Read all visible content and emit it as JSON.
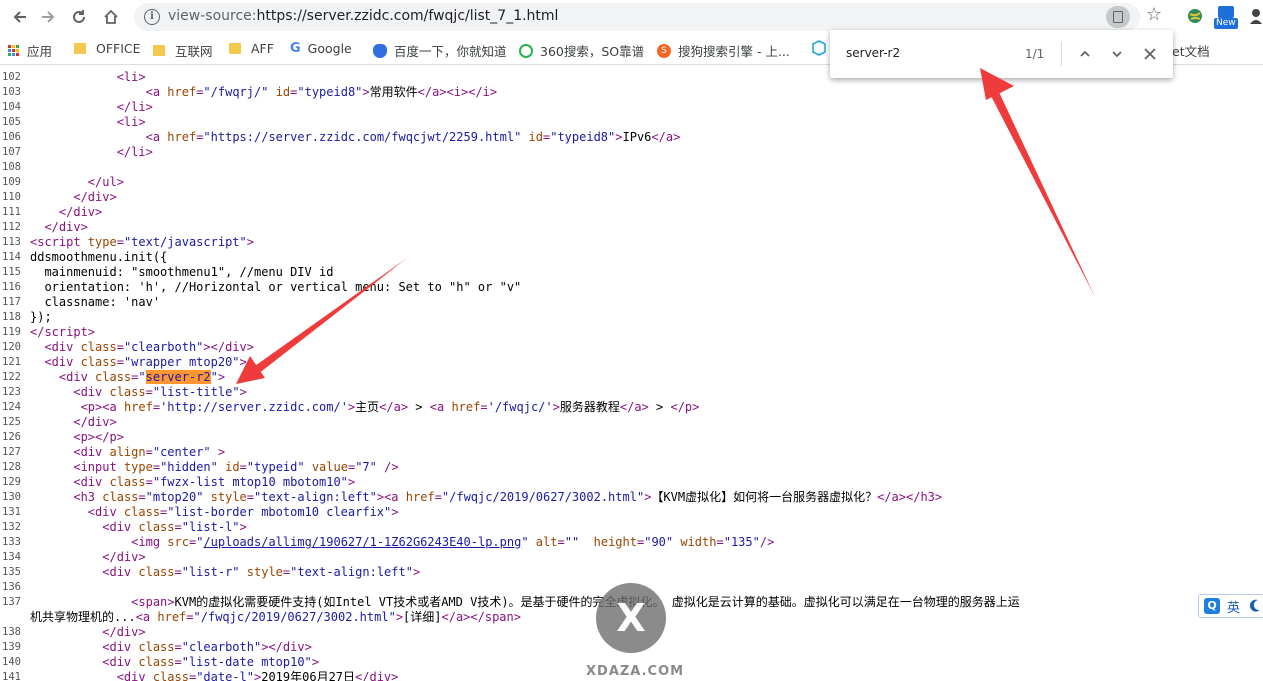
{
  "browser": {
    "url_prefix": "view-source:",
    "url_main": "https://server.zzidc.com/fwqjc/list_7_1.html",
    "new_badge": "New"
  },
  "bookmarks": [
    {
      "label": "应用",
      "icon": "apps-grid-icon"
    },
    {
      "label": "OFFICE",
      "icon": "folder-icon"
    },
    {
      "label": "互联网",
      "icon": "folder-icon"
    },
    {
      "label": "AFF",
      "icon": "folder-icon"
    },
    {
      "label": "Google",
      "icon": "google-icon"
    },
    {
      "label": "百度一下，你就知道",
      "icon": "baidu-icon"
    },
    {
      "label": "360搜索，SO靠谱",
      "icon": "so360-icon"
    },
    {
      "label": "搜狗搜索引擎 - 上...",
      "icon": "sogou-icon"
    },
    {
      "label": "et文档",
      "icon": "doc-icon"
    }
  ],
  "find_bar": {
    "query": "server-r2",
    "count": "1/1"
  },
  "code_lines": [
    {
      "n": "102",
      "html": "            <span class=\"t\">&lt;li&gt;</span>"
    },
    {
      "n": "103",
      "html": "                <span class=\"t\">&lt;a </span><span class=\"a\">href</span><span class=\"t\">=</span><span class=\"v\">\"/fwqrj/\"</span> <span class=\"a\">id</span><span class=\"t\">=</span><span class=\"v\">\"typeid8\"</span><span class=\"t\">&gt;</span>常用软件<span class=\"t\">&lt;/a&gt;&lt;i&gt;&lt;/i&gt;</span>"
    },
    {
      "n": "104",
      "html": "            <span class=\"t\">&lt;/li&gt;</span>"
    },
    {
      "n": "105",
      "html": "            <span class=\"t\">&lt;li&gt;</span>"
    },
    {
      "n": "106",
      "html": "                <span class=\"t\">&lt;a </span><span class=\"a\">href</span><span class=\"t\">=</span><span class=\"v\">\"https://server.zzidc.com/fwqcjwt/2259.html\"</span> <span class=\"a\">id</span><span class=\"t\">=</span><span class=\"v\">\"typeid8\"</span><span class=\"t\">&gt;</span>IPv6<span class=\"t\">&lt;/a&gt;</span>"
    },
    {
      "n": "107",
      "html": "            <span class=\"t\">&lt;/li&gt;</span>"
    },
    {
      "n": "108",
      "html": ""
    },
    {
      "n": "109",
      "html": "        <span class=\"t\">&lt;/ul&gt;</span>"
    },
    {
      "n": "110",
      "html": "      <span class=\"t\">&lt;/div&gt;</span>"
    },
    {
      "n": "111",
      "html": "    <span class=\"t\">&lt;/div&gt;</span>"
    },
    {
      "n": "112",
      "html": "  <span class=\"t\">&lt;/div&gt;</span>"
    },
    {
      "n": "113",
      "html": "<span class=\"t\">&lt;script </span><span class=\"a\">type</span><span class=\"t\">=</span><span class=\"v\">\"text/javascript\"</span><span class=\"t\">&gt;</span>"
    },
    {
      "n": "114",
      "html": "ddsmoothmenu.init({"
    },
    {
      "n": "115",
      "html": "  mainmenuid: \"smoothmenu1\", //menu DIV id"
    },
    {
      "n": "116",
      "html": "  orientation: 'h', //Horizontal or vertical menu: Set to \"h\" or \"v\""
    },
    {
      "n": "117",
      "html": "  classname: 'nav'"
    },
    {
      "n": "118",
      "html": "});"
    },
    {
      "n": "119",
      "html": "<span class=\"t\">&lt;/script&gt;</span>"
    },
    {
      "n": "120",
      "html": "  <span class=\"t\">&lt;div </span><span class=\"a\">class</span><span class=\"t\">=</span><span class=\"v\">\"clearboth\"</span><span class=\"t\">&gt;&lt;/div&gt;</span>"
    },
    {
      "n": "121",
      "html": "  <span class=\"t\">&lt;div </span><span class=\"a\">class</span><span class=\"t\">=</span><span class=\"v\">\"wrapper mtop20\"</span><span class=\"t\">&gt;</span>"
    },
    {
      "n": "122",
      "html": "    <span class=\"t\">&lt;div </span><span class=\"a\">class</span><span class=\"t\">=</span><span class=\"v\">\"<span class=\"hl\">server-r2</span>\"</span><span class=\"t\">&gt;</span>"
    },
    {
      "n": "123",
      "html": "      <span class=\"t\">&lt;div </span><span class=\"a\">class</span><span class=\"t\">=</span><span class=\"v\">\"list-title\"</span><span class=\"t\">&gt;</span>"
    },
    {
      "n": "124",
      "html": "       <span class=\"t\">&lt;p&gt;&lt;a </span><span class=\"a\">href</span><span class=\"t\">=</span><span class=\"v\">'http://server.zzidc.com/'</span><span class=\"t\">&gt;</span>主页<span class=\"t\">&lt;/a&gt;</span> &gt; <span class=\"t\">&lt;a </span><span class=\"a\">href</span><span class=\"t\">=</span><span class=\"v\">'/fwqjc/'</span><span class=\"t\">&gt;</span>服务器教程<span class=\"t\">&lt;/a&gt;</span> &gt; <span class=\"t\">&lt;/p&gt;</span>"
    },
    {
      "n": "125",
      "html": "      <span class=\"t\">&lt;/div&gt;</span>"
    },
    {
      "n": "126",
      "html": "      <span class=\"t\">&lt;p&gt;&lt;/p&gt;</span>"
    },
    {
      "n": "127",
      "html": "      <span class=\"t\">&lt;div </span><span class=\"a\">align</span><span class=\"t\">=</span><span class=\"v\">\"center\"</span> <span class=\"t\">&gt;</span>"
    },
    {
      "n": "128",
      "html": "      <span class=\"t\">&lt;input </span><span class=\"a\">type</span><span class=\"t\">=</span><span class=\"v\">\"hidden\"</span> <span class=\"a\">id</span><span class=\"t\">=</span><span class=\"v\">\"typeid\"</span> <span class=\"a\">value</span><span class=\"t\">=</span><span class=\"v\">\"7\"</span> <span class=\"t\">/&gt;</span>"
    },
    {
      "n": "129",
      "html": "      <span class=\"t\">&lt;div </span><span class=\"a\">class</span><span class=\"t\">=</span><span class=\"v\">\"fwzx-list mtop10 mbotom10\"</span><span class=\"t\">&gt;</span>"
    },
    {
      "n": "130",
      "html": "      <span class=\"t\">&lt;h3 </span><span class=\"a\">class</span><span class=\"t\">=</span><span class=\"v\">\"mtop20\"</span> <span class=\"a\">style</span><span class=\"t\">=</span><span class=\"v\">\"text-align:left\"</span><span class=\"t\">&gt;&lt;a </span><span class=\"a\">href</span><span class=\"t\">=</span><span class=\"v\">\"/fwqjc/2019/0627/3002.html\"</span><span class=\"t\">&gt;</span>【KVM虚拟化】如何将一台服务器虚拟化？<span class=\"t\">&lt;/a&gt;&lt;/h3&gt;</span>"
    },
    {
      "n": "131",
      "html": "        <span class=\"t\">&lt;div </span><span class=\"a\">class</span><span class=\"t\">=</span><span class=\"v\">\"list-border mbotom10 clearfix\"</span><span class=\"t\">&gt;</span>"
    },
    {
      "n": "132",
      "html": "          <span class=\"t\">&lt;div </span><span class=\"a\">class</span><span class=\"t\">=</span><span class=\"v\">\"list-l\"</span><span class=\"t\">&gt;</span>"
    },
    {
      "n": "133",
      "html": "              <span class=\"t\">&lt;img </span><span class=\"a\">src</span><span class=\"t\">=</span><span class=\"v\">\"<span class=\"lk\">/uploads/allimg/190627/1-1Z62G6243E40-lp.png</span>\"</span> <span class=\"a\">alt</span><span class=\"t\">=</span><span class=\"v\">\"\"</span>  <span class=\"a\">height</span><span class=\"t\">=</span><span class=\"v\">\"90\"</span> <span class=\"a\">width</span><span class=\"t\">=</span><span class=\"v\">\"135\"</span><span class=\"t\">/&gt;</span>"
    },
    {
      "n": "134",
      "html": "          <span class=\"t\">&lt;/div&gt;</span>"
    },
    {
      "n": "135",
      "html": "          <span class=\"t\">&lt;div </span><span class=\"a\">class</span><span class=\"t\">=</span><span class=\"v\">\"list-r\"</span> <span class=\"a\">style</span><span class=\"t\">=</span><span class=\"v\">\"text-align:left\"</span><span class=\"t\">&gt;</span>"
    },
    {
      "n": "136",
      "html": ""
    },
    {
      "n": "137",
      "html": "              <span class=\"t\">&lt;span&gt;</span>KVM的虚拟化需要硬件支持(如Intel VT技术或者AMD V技术)。是基于硬件的完全虚拟化。 虚拟化是云计算的基础。虚拟化可以满足在一台物理的服务器上运"
    },
    {
      "n": "",
      "html": "机共享物理机的...<span class=\"t\">&lt;a </span><span class=\"a\">href</span><span class=\"t\">=</span><span class=\"v\">\"/fwqjc/2019/0627/3002.html\"</span><span class=\"t\">&gt;</span>[详细]<span class=\"t\">&lt;/a&gt;&lt;/span&gt;</span>",
      "wrap": true
    },
    {
      "n": "138",
      "html": "          <span class=\"t\">&lt;/div&gt;</span>"
    },
    {
      "n": "139",
      "html": "          <span class=\"t\">&lt;div </span><span class=\"a\">class</span><span class=\"t\">=</span><span class=\"v\">\"clearboth\"</span><span class=\"t\">&gt;&lt;/div&gt;</span>"
    },
    {
      "n": "140",
      "html": "          <span class=\"t\">&lt;div </span><span class=\"a\">class</span><span class=\"t\">=</span><span class=\"v\">\"list-date mtop10\"</span><span class=\"t\">&gt;</span>"
    },
    {
      "n": "141",
      "html": "            <span class=\"t\">&lt;div </span><span class=\"a\">class</span><span class=\"t\">=</span><span class=\"v\">\"date-l\"</span><span class=\"t\">&gt;</span>2019年06月27日<span class=\"t\">&lt;/div&gt;</span>"
    }
  ],
  "ime": {
    "lang": "英"
  },
  "watermark": {
    "letter": "X",
    "text": "XDAZA.COM"
  },
  "colors": {
    "highlight": "#ff9632",
    "annotation_arrow": "#ef3b3b",
    "tag": "#881280",
    "attr": "#994500",
    "value": "#1a1aa6"
  }
}
